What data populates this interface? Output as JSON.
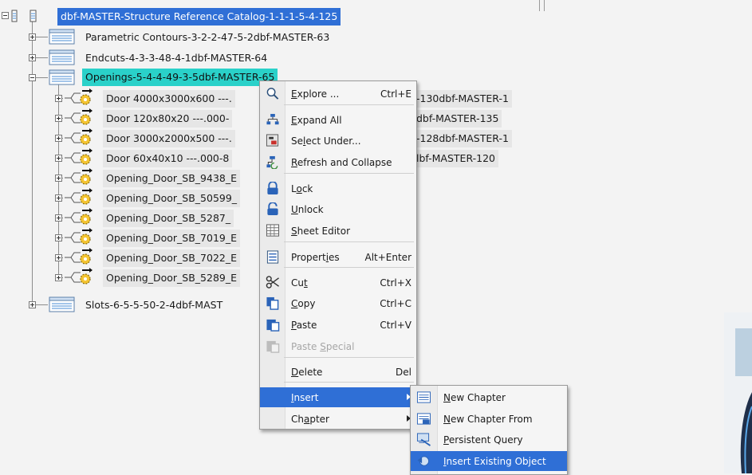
{
  "colors": {
    "selection_blue": "#2f6fd6",
    "highlight_cyan": "#2ad1c9",
    "background": "#f3f3f3"
  },
  "tree": {
    "root": {
      "label": "dbf-MASTER-Structure Reference Catalog-1-1-1-5-4-125",
      "icon": "catalog-icon"
    },
    "chapters": [
      {
        "label": "Parametric Contours-3-2-2-47-5-2dbf-MASTER-63",
        "icon": "chapter-icon"
      },
      {
        "label": "Endcuts-4-3-3-48-4-1dbf-MASTER-64",
        "icon": "chapter-icon"
      },
      {
        "label": "Openings-5-4-4-49-3-5dbf-MASTER-65",
        "icon": "chapter-icon"
      },
      {
        "label": "Slots-6-5-5-50-2-4dbf-MAST",
        "icon": "chapter-icon"
      }
    ],
    "openings_children": [
      {
        "label": "Door 4000x3000x600 ---.",
        "tail": "-130dbf-MASTER-1"
      },
      {
        "label": "Door 120x80x20 ---.000-",
        "tail": "dbf-MASTER-135"
      },
      {
        "label": "Door 3000x2000x500 ---.",
        "tail": "-128dbf-MASTER-1"
      },
      {
        "label": "Door 60x40x10 ---.000-8",
        "tail": "lbf-MASTER-120"
      },
      {
        "label": "Opening_Door_SB_9438_E",
        "tail": ""
      },
      {
        "label": "Opening_Door_SB_50599_",
        "tail": ""
      },
      {
        "label": "Opening_Door_SB_5287_",
        "tail": ""
      },
      {
        "label": "Opening_Door_SB_7019_E",
        "tail": ""
      },
      {
        "label": "Opening_Door_SB_7022_E",
        "tail": ""
      },
      {
        "label": "Opening_Door_SB_5289_E",
        "tail": ""
      }
    ]
  },
  "context_menu": {
    "items": [
      {
        "pre": "",
        "ul": "E",
        "post": "xplore ...",
        "shortcut": "Ctrl+E",
        "icon": "explore-icon"
      },
      {
        "pre": "",
        "ul": "E",
        "post": "xpand All",
        "shortcut": "",
        "icon": "expand-all-icon"
      },
      {
        "pre": "Se",
        "ul": "l",
        "post": "ect Under...",
        "shortcut": "",
        "icon": "select-under-icon"
      },
      {
        "pre": "",
        "ul": "R",
        "post": "efresh and Collapse",
        "shortcut": "",
        "icon": "refresh-collapse-icon"
      },
      {
        "pre": "L",
        "ul": "o",
        "post": "ck",
        "shortcut": "",
        "icon": "lock-icon"
      },
      {
        "pre": "",
        "ul": "U",
        "post": "nlock",
        "shortcut": "",
        "icon": "unlock-icon"
      },
      {
        "pre": "",
        "ul": "S",
        "post": "heet Editor",
        "shortcut": "",
        "icon": "sheet-editor-icon"
      },
      {
        "pre": "Propert",
        "ul": "i",
        "post": "es",
        "shortcut": "Alt+Enter",
        "icon": "properties-icon"
      },
      {
        "pre": "Cu",
        "ul": "t",
        "post": "",
        "shortcut": "Ctrl+X",
        "icon": "scissors-icon"
      },
      {
        "pre": "",
        "ul": "C",
        "post": "opy",
        "shortcut": "Ctrl+C",
        "icon": "copy-icon"
      },
      {
        "pre": "",
        "ul": "P",
        "post": "aste",
        "shortcut": "Ctrl+V",
        "icon": "paste-icon"
      },
      {
        "pre": "Paste ",
        "ul": "S",
        "post": "pecial",
        "shortcut": "",
        "icon": "paste-special-icon"
      },
      {
        "pre": "",
        "ul": "D",
        "post": "elete",
        "shortcut": "Del",
        "icon": ""
      },
      {
        "pre": "",
        "ul": "I",
        "post": "nsert",
        "shortcut": "",
        "icon": ""
      },
      {
        "pre": "Ch",
        "ul": "a",
        "post": "pter",
        "shortcut": "",
        "icon": ""
      }
    ]
  },
  "insert_submenu": {
    "items": [
      {
        "pre": "",
        "ul": "N",
        "post": "ew Chapter",
        "icon": "new-chapter-icon"
      },
      {
        "pre": "",
        "ul": "N",
        "post": "ew Chapter From",
        "icon": "new-chapter-from-icon"
      },
      {
        "pre": "",
        "ul": "P",
        "post": "ersistent Query",
        "icon": "persistent-query-icon"
      },
      {
        "pre": "",
        "ul": "I",
        "post": "nsert Existing Object",
        "icon": "insert-existing-object-icon"
      }
    ]
  }
}
